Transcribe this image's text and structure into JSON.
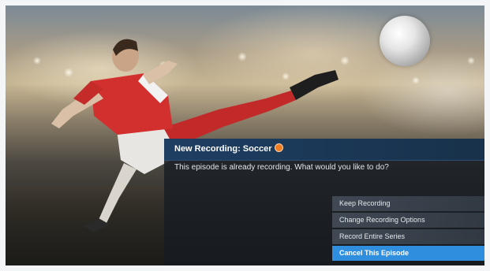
{
  "dialog": {
    "title": "New Recording: Soccer",
    "title_icon": "record-icon",
    "message": "This episode is already recording. What would you like to do?",
    "options": [
      {
        "label": "Keep Recording",
        "selected": false
      },
      {
        "label": "Change Recording Options",
        "selected": false
      },
      {
        "label": "Record Entire Series",
        "selected": false
      },
      {
        "label": "Cancel This Episode",
        "selected": true
      }
    ]
  },
  "colors": {
    "header_bg": "#1e3e62",
    "selected_option_bg": "#2f8fde",
    "record_icon": "#f07c23"
  }
}
